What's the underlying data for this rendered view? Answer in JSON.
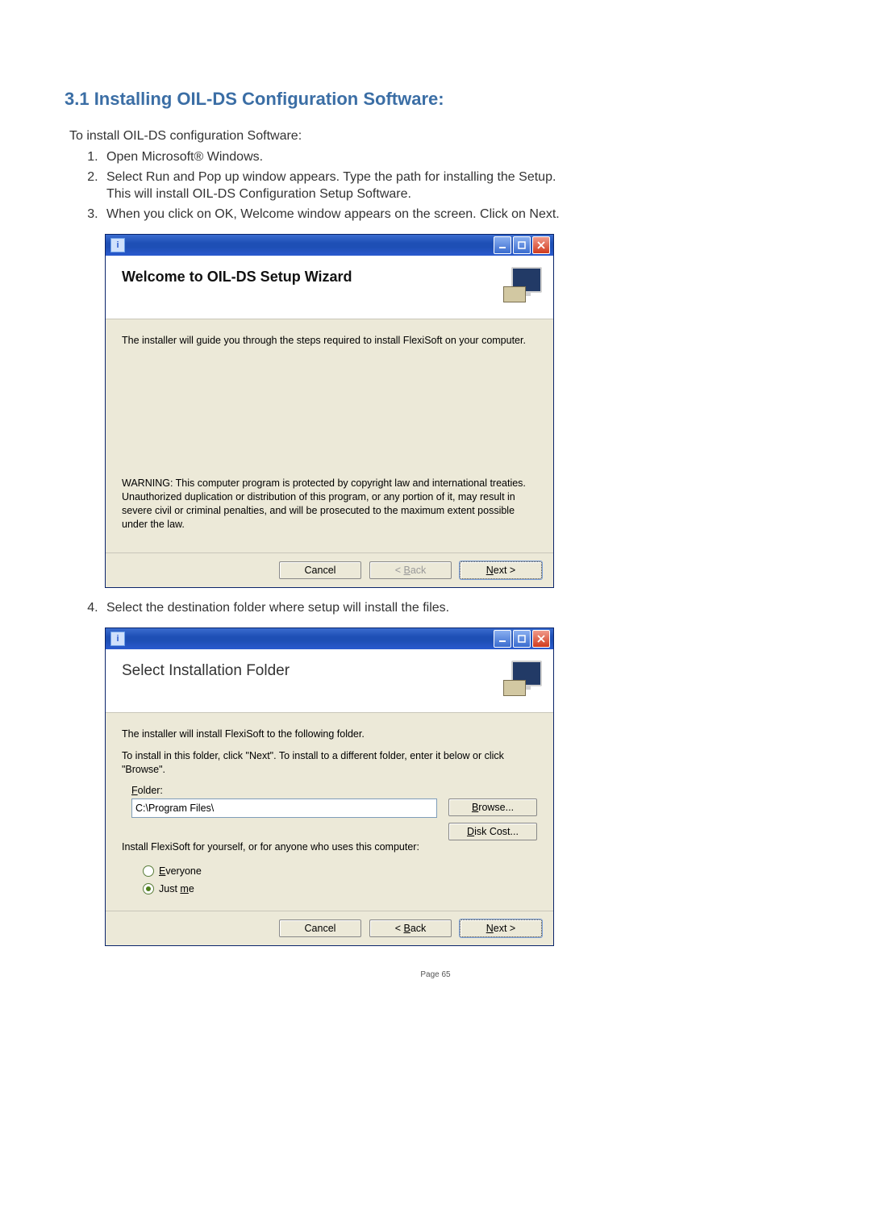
{
  "heading": "3.1  Installing OIL-DS Configuration Software:",
  "intro": "To install OIL-DS configuration Software:",
  "steps": {
    "s1": "Open Microsoft® Windows.",
    "s2a": "Select Run and Pop up window appears. Type the path for installing the Setup.",
    "s2b": "This will install OIL-DS Configuration Setup Software.",
    "s3": "When you click on OK, Welcome window appears on the screen. Click on Next.",
    "s4": "Select the destination folder where setup will install the files."
  },
  "win1": {
    "title": "",
    "banner_title": "Welcome to OIL-DS Setup Wizard",
    "body1": "The installer will guide you through the steps required to install FlexiSoft on your computer.",
    "warning": "WARNING: This computer program is protected by copyright law and international treaties. Unauthorized duplication or distribution of this program, or any portion of it, may result in severe civil or criminal penalties, and will be prosecuted to the maximum extent possible under the law.",
    "btn_cancel": "Cancel",
    "btn_back_full": "< Back",
    "btn_next_full": "Next >"
  },
  "win2": {
    "title": "",
    "banner_title": "Select Installation Folder",
    "body1": "The installer will install FlexiSoft to the following folder.",
    "body2": "To install in this folder, click \"Next\". To install to a different folder, enter it below or click \"Browse\".",
    "folder_label": "Folder:",
    "folder_value": "C:\\Program Files\\",
    "btn_browse": "Browse...",
    "btn_diskcost": "Disk Cost...",
    "question": "Install FlexiSoft for yourself, or for anyone who uses this computer:",
    "opt_everyone": "Everyone",
    "opt_justme": "Just me",
    "btn_cancel": "Cancel",
    "btn_back_full": "< Back",
    "btn_next_full": "Next >"
  },
  "page_number": "Page 65"
}
